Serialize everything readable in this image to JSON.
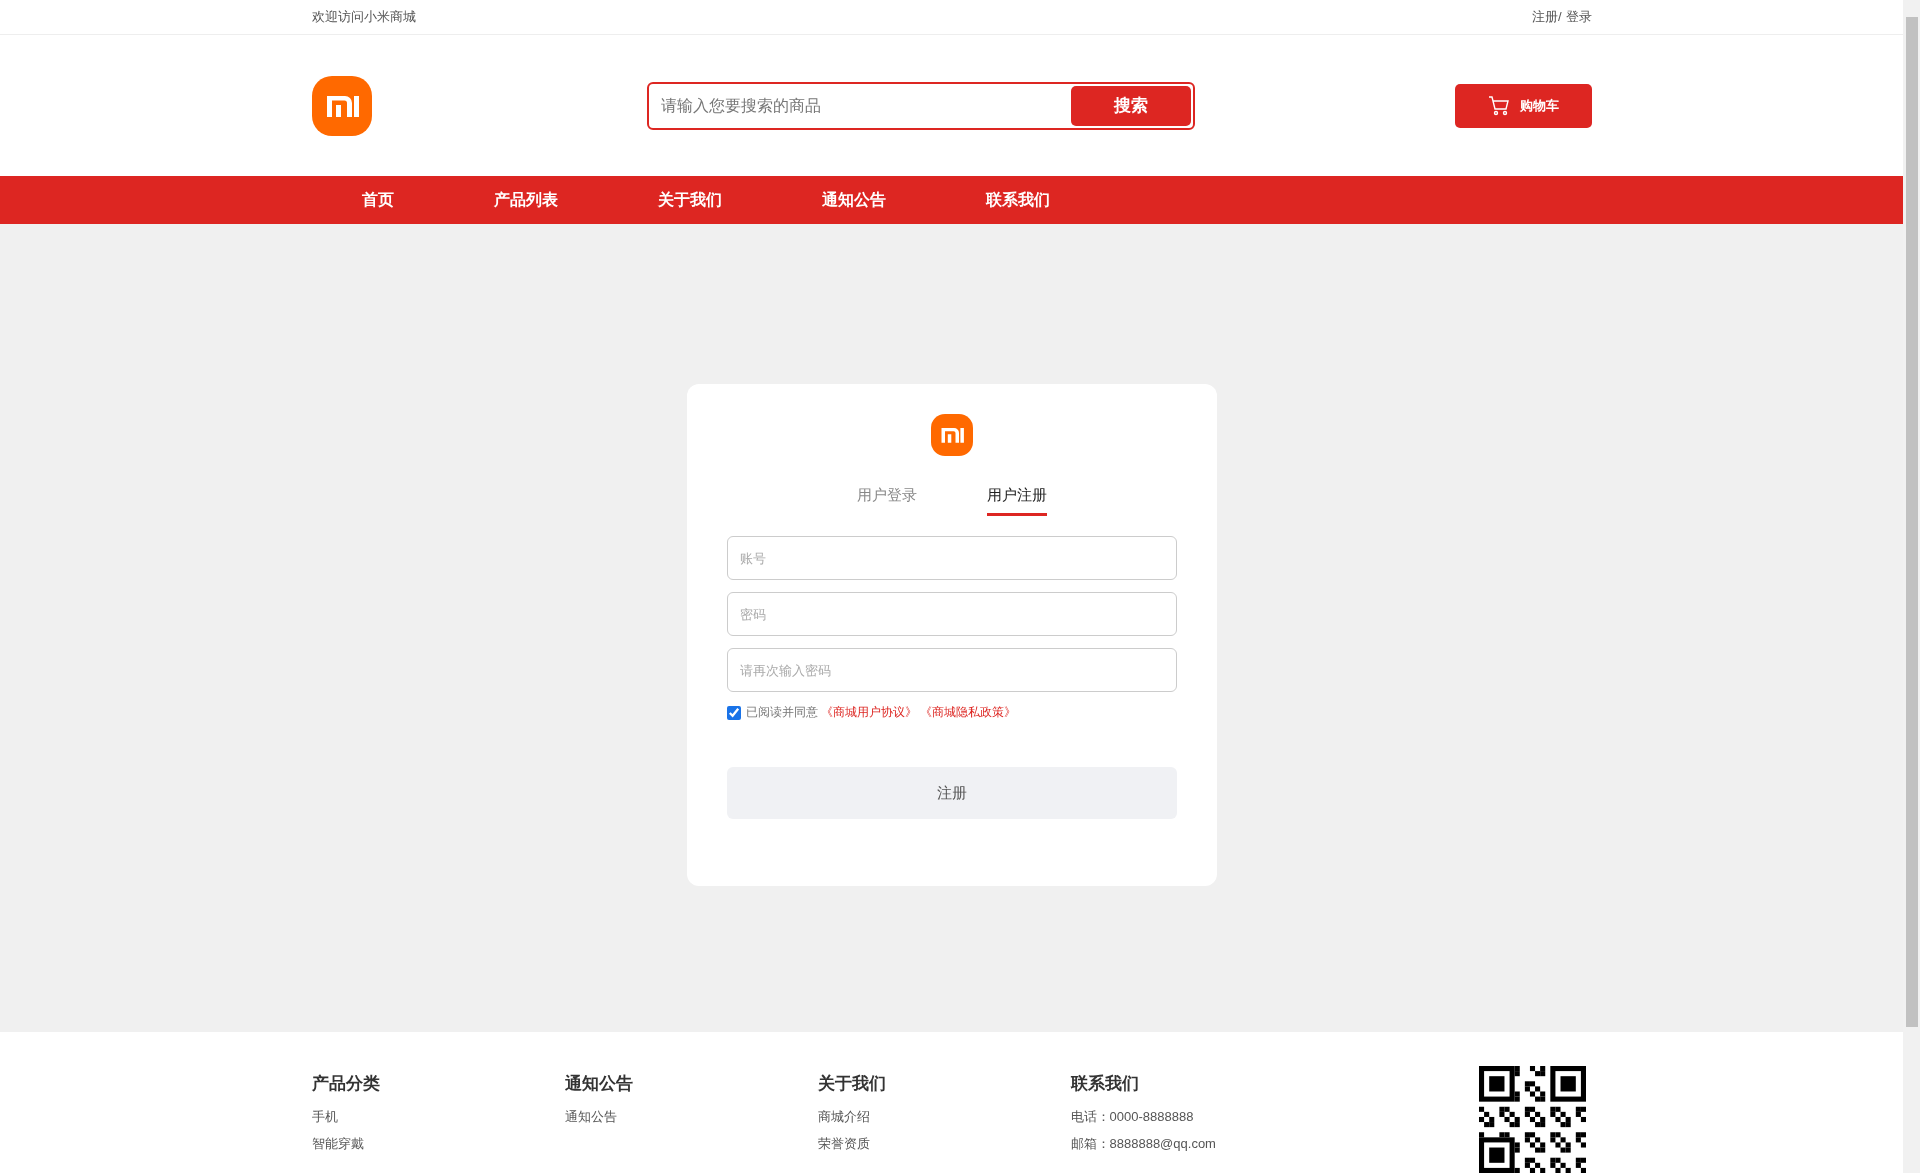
{
  "top_bar": {
    "welcome": "欢迎访问小米商城",
    "register": "注册/",
    "login": "登录"
  },
  "header": {
    "search": {
      "placeholder": "请输入您要搜索的商品",
      "button": "搜索"
    },
    "cart_button": "购物车"
  },
  "nav": [
    {
      "label": "首页"
    },
    {
      "label": "产品列表"
    },
    {
      "label": "关于我们"
    },
    {
      "label": "通知公告"
    },
    {
      "label": "联系我们"
    }
  ],
  "auth_card": {
    "tabs": [
      {
        "label": "用户登录",
        "selected": false
      },
      {
        "label": "用户注册",
        "selected": true
      }
    ],
    "fields": [
      {
        "placeholder": "账号"
      },
      {
        "placeholder": "密码"
      },
      {
        "placeholder": "请再次输入密码"
      }
    ],
    "agreement": {
      "checked": true,
      "text": "已阅读并同意",
      "links": [
        "《商城用户协议》",
        "《商城隐私政策》"
      ]
    },
    "submit": "注册"
  },
  "footer": {
    "columns": [
      {
        "title": "产品分类",
        "items": [
          "手机",
          "智能穿戴"
        ]
      },
      {
        "title": "通知公告",
        "items": [
          "通知公告"
        ]
      },
      {
        "title": "关于我们",
        "items": [
          "商城介绍",
          "荣誉资质"
        ]
      },
      {
        "title": "联系我们",
        "items": [
          "电话：0000-8888888",
          "邮箱：8888888@qq.com"
        ]
      }
    ]
  }
}
